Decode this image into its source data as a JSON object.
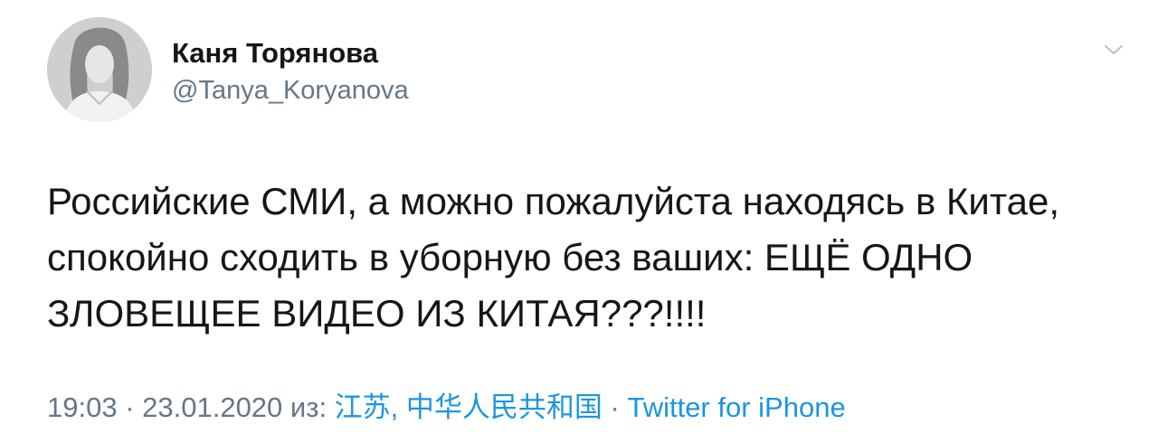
{
  "tweet": {
    "author_name": "Каня Торянова",
    "author_handle": "@Tanya_Koryanova",
    "text": "Российские СМИ, а можно пожалуйста находясь в Китае,\nспокойно сходить в уборную без ваших: ЕЩЁ ОДНО\nЗЛОВЕЩЕЕ ВИДЕО ИЗ КИТАЯ???!!!!",
    "time": "19:03",
    "separator": " · ",
    "date": "23.01.2020",
    "location_prefix": " из: ",
    "location": "江苏, 中华人民共和国",
    "source": "Twitter for iPhone"
  },
  "icons": {
    "caret": "chevron-down-icon",
    "avatar": "profile-photo"
  },
  "colors": {
    "text": "#14171a",
    "secondary": "#657786",
    "link": "#1b95e0",
    "background": "#ffffff"
  }
}
